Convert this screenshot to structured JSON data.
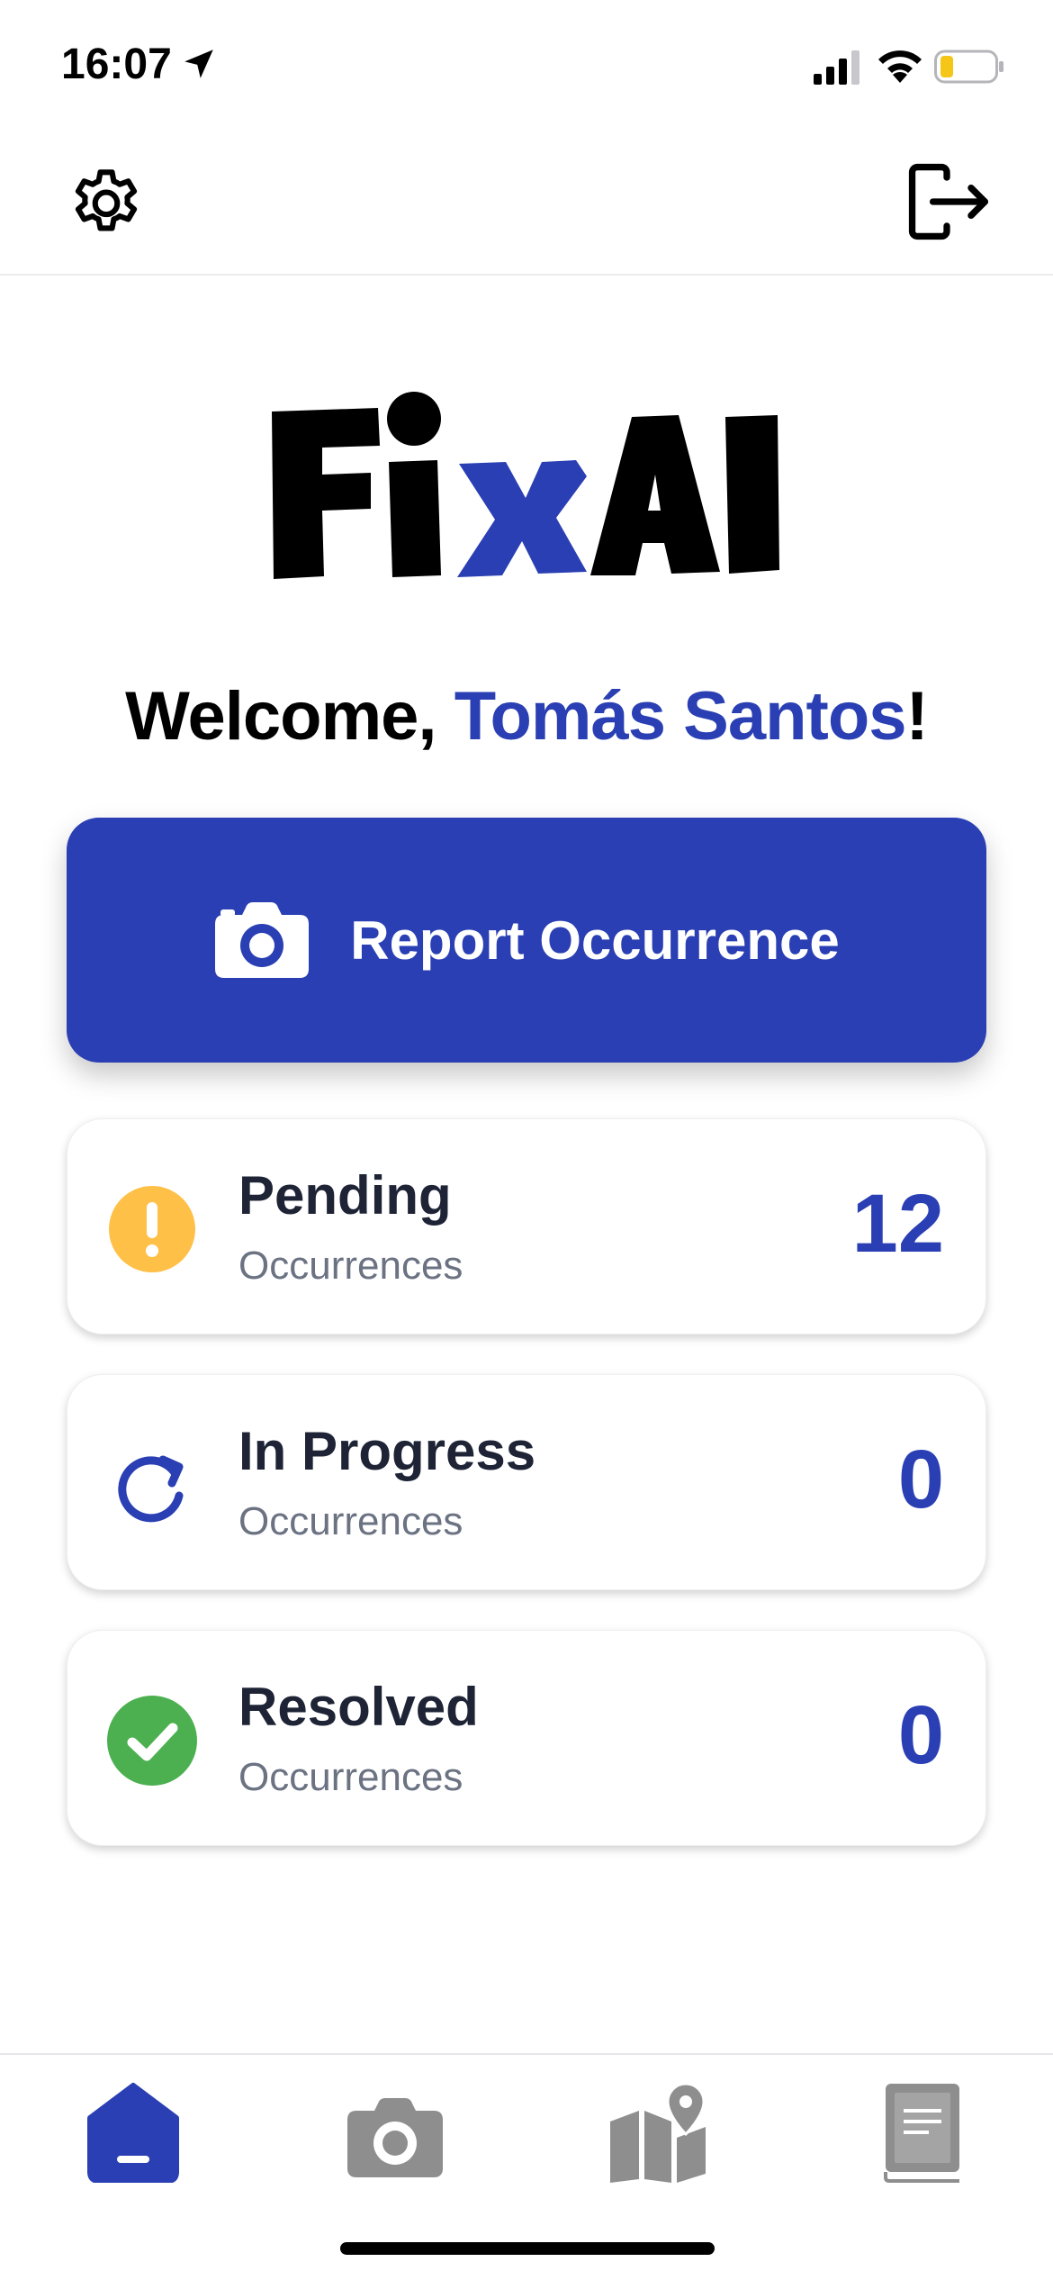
{
  "status_bar": {
    "time": "16:07"
  },
  "welcome": {
    "greeting": "Welcome,",
    "user_name": "Tomás Santos",
    "suffix": "!"
  },
  "report_button": {
    "label": "Report Occurrence",
    "icon": "camera-icon"
  },
  "cards": [
    {
      "title": "Pending",
      "subtitle": "Occurrences",
      "count": "12",
      "icon": "exclamation-icon",
      "color": "#ffc048"
    },
    {
      "title": "In Progress",
      "subtitle": "Occurrences",
      "count": "0",
      "icon": "refresh-icon",
      "color": "#2a3fb3"
    },
    {
      "title": "Resolved",
      "subtitle": "Occurrences",
      "count": "0",
      "icon": "check-icon",
      "color": "#4cb050"
    }
  ],
  "tab_bar": {
    "items": [
      {
        "icon": "home-icon",
        "active": true
      },
      {
        "icon": "camera-icon",
        "active": false
      },
      {
        "icon": "map-icon",
        "active": false
      },
      {
        "icon": "book-icon",
        "active": false
      }
    ]
  },
  "colors": {
    "brand": "#2a3fb3",
    "inactive_tab": "#8e8e8e",
    "battery_low": "#f5c518"
  }
}
